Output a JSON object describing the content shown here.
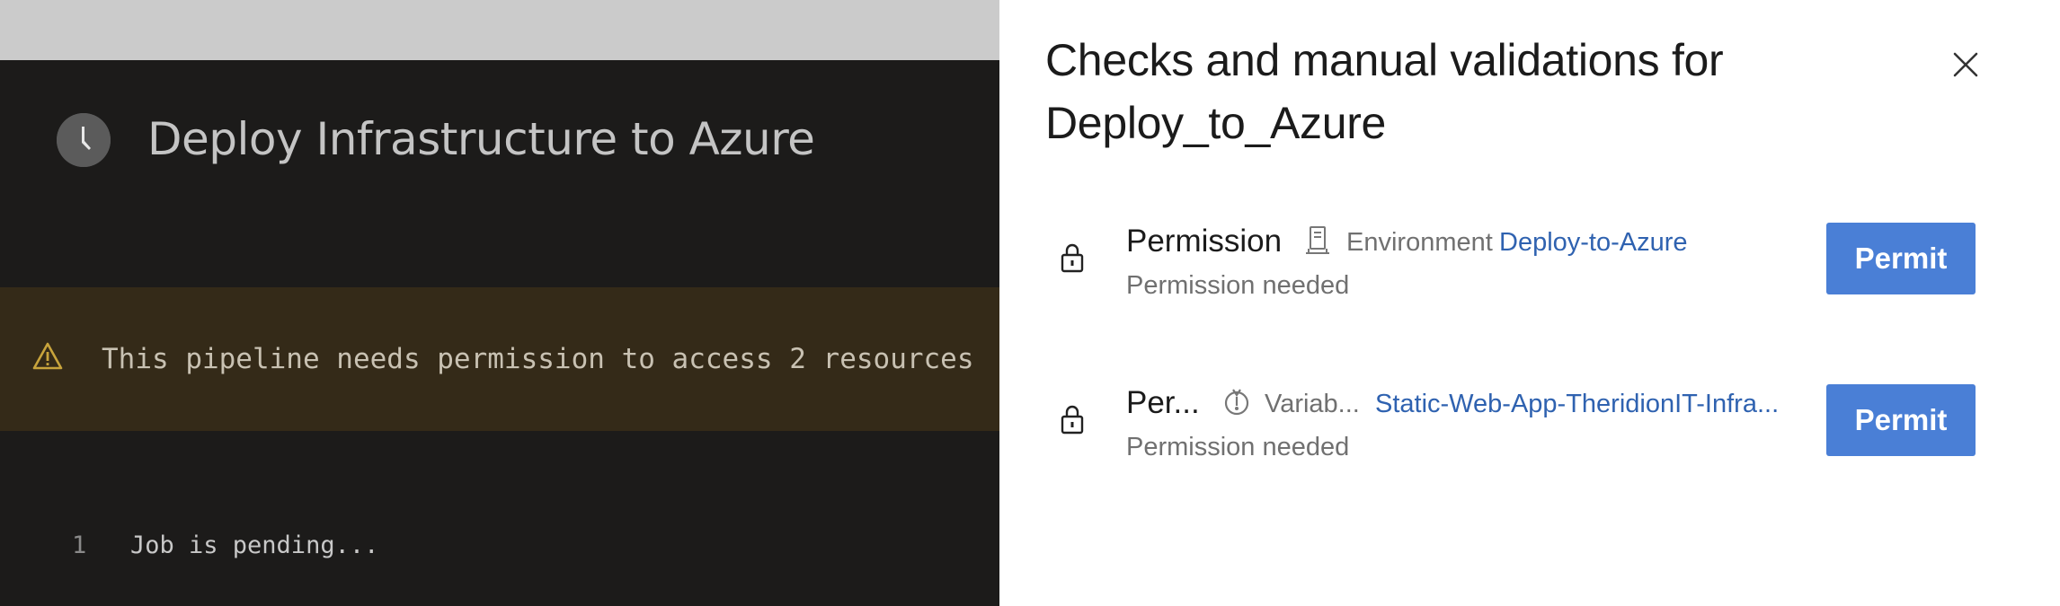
{
  "job": {
    "title": "Deploy Infrastructure to Azure",
    "status_icon": "clock-icon"
  },
  "warning": {
    "icon": "warning-icon",
    "text": "This pipeline needs permission to access 2 resources"
  },
  "log": {
    "lines": [
      {
        "number": "1",
        "text": "Job is pending..."
      }
    ]
  },
  "panel": {
    "title_line1": "Checks and manual validations for",
    "title_line2": "Deploy_to_Azure",
    "close_icon": "close-icon",
    "checks": [
      {
        "name": "Permission",
        "resource_icon": "environment-icon",
        "resource_type": "Environment",
        "resource_name": "Deploy-to-Azure",
        "status": "Permission needed",
        "action_label": "Permit"
      },
      {
        "name": "Per...",
        "resource_icon": "variable-group-icon",
        "resource_type": "Variab...",
        "resource_name": "Static-Web-App-TheridionIT-Infra...",
        "status": "Permission needed",
        "action_label": "Permit"
      }
    ]
  },
  "colors": {
    "accent": "#4a7fd6",
    "link": "#2f62b0",
    "warning_bg": "#342a18",
    "log_bg": "#1c1b1a"
  }
}
